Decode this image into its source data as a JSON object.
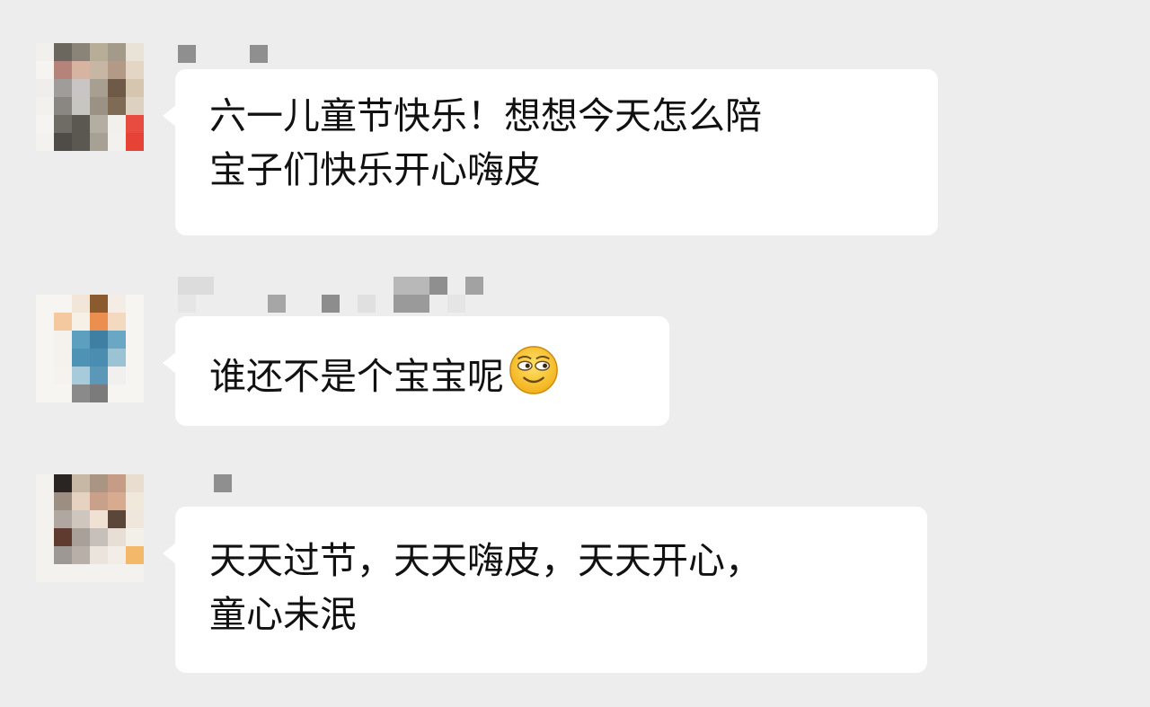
{
  "chat": {
    "messages": [
      {
        "sender": "",
        "lines": [
          "六一儿童节快乐！想想今天怎么陪",
          "宝子们快乐开心嗨皮"
        ],
        "avatar_icon": "pixelated-avatar-icon"
      },
      {
        "sender": "",
        "lines": [
          "谁还不是个宝宝呢"
        ],
        "emoji": "grin-emoji-icon",
        "avatar_icon": "pixelated-avatar-icon"
      },
      {
        "sender": "",
        "lines": [
          "天天过节，天天嗨皮，天天开心，",
          "童心未泯"
        ],
        "avatar_icon": "pixelated-avatar-icon"
      }
    ]
  },
  "colors": {
    "background": "#ededed",
    "bubble": "#ffffff",
    "text": "#111111"
  }
}
